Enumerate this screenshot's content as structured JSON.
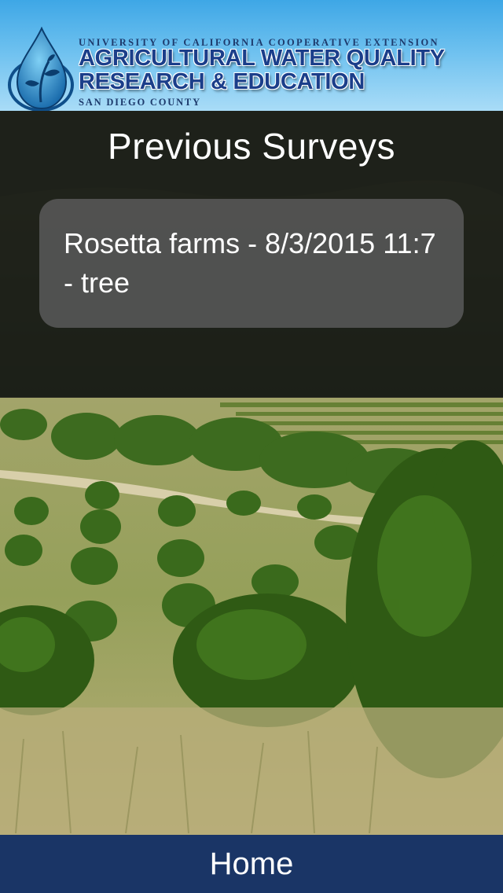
{
  "banner": {
    "line1": "UNIVERSITY OF CALIFORNIA COOPERATIVE EXTENSION",
    "line2": "AGRICULTURAL WATER QUALITY",
    "line3": "RESEARCH & EDUCATION",
    "line4": "SAN DIEGO COUNTY",
    "logo_icon": "water-drop-plant-icon"
  },
  "page": {
    "title": "Previous Surveys"
  },
  "surveys": [
    {
      "label": "Rosetta farms - 8/3/2015 11:7 - tree"
    }
  ],
  "nav": {
    "home_label": "Home"
  },
  "colors": {
    "banner_sky": "#6cc0ef",
    "banner_text": "#1b3e8a",
    "overlay": "#161616",
    "card": "#585858",
    "nav_bar": "#1a3566",
    "text_light": "#ffffff"
  }
}
